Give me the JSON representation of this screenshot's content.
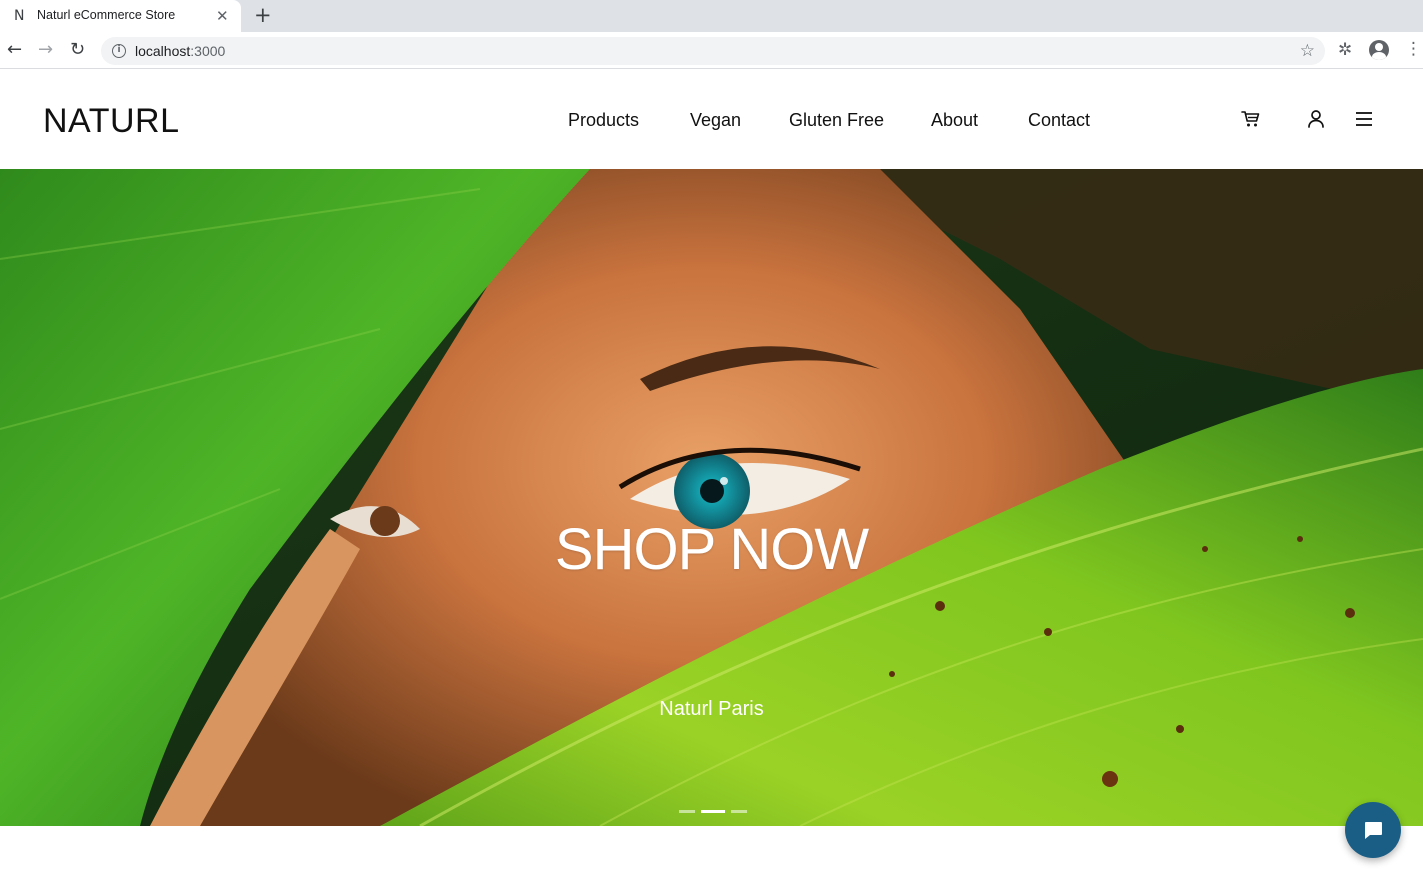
{
  "browser": {
    "tab_favicon": "N",
    "tab_title": "Naturl eCommerce Store",
    "url_host": "localhost",
    "url_port": ":3000",
    "icons": [
      "back-arrow-icon",
      "forward-arrow-icon",
      "reload-icon",
      "info-icon",
      "star-icon",
      "puzzle-icon",
      "profile-icon",
      "kebab-menu-icon"
    ]
  },
  "header": {
    "logo": "NATURL",
    "nav": [
      {
        "label": "Products"
      },
      {
        "label": "Vegan"
      },
      {
        "label": "Gluten Free"
      },
      {
        "label": "About"
      },
      {
        "label": "Contact"
      }
    ],
    "icons": [
      "cart-icon",
      "user-icon",
      "hamburger-icon"
    ]
  },
  "hero": {
    "title": "SHOP NOW",
    "subtitle": "Naturl Paris",
    "slides_total": 3,
    "active_slide": 2
  },
  "chat": {
    "icon": "chat-bubble-icon",
    "color": "#1a5e86"
  }
}
